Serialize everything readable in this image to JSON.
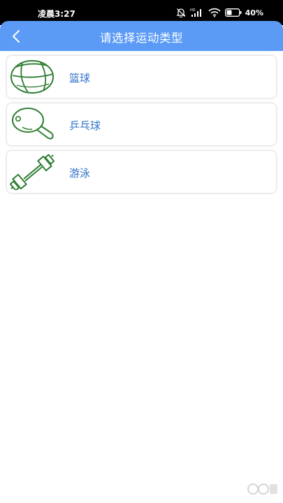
{
  "status_bar": {
    "time": "凌晨3:27",
    "battery_percent": "40%",
    "network_label": "HD",
    "icons": [
      "alarm-off-icon",
      "signal-icon",
      "wifi-icon",
      "battery-icon"
    ]
  },
  "header": {
    "back_icon": "chevron-left-icon",
    "title": "请选择运动类型",
    "background_color": "#5b9bf6"
  },
  "sports": [
    {
      "label": "篮球",
      "icon": "basketball-icon"
    },
    {
      "label": "乒乓球",
      "icon": "ping-pong-paddle-icon"
    },
    {
      "label": "游泳",
      "icon": "dumbbell-icon"
    }
  ],
  "colors": {
    "icon_stroke": "#2e7d32",
    "label_text": "#2f72c9"
  }
}
